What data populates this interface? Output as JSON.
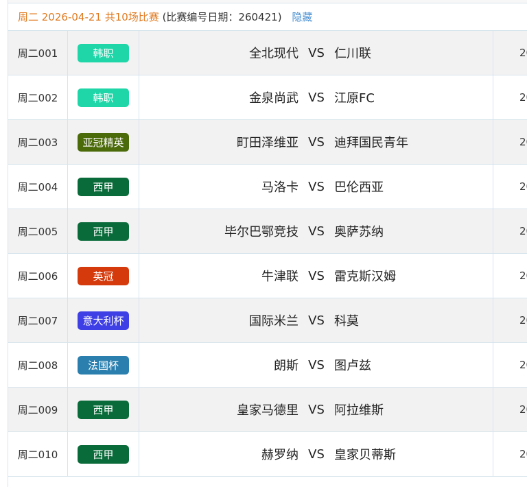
{
  "header": {
    "date_text": "周二 2026-04-21 共10场比赛",
    "code_text": "(比赛编号日期：260421)",
    "hide_link": "隐藏"
  },
  "vs_label": "VS",
  "matches": [
    {
      "id": "周二001",
      "league": "韩职",
      "color": "#1ed6a8",
      "home": "全北现代",
      "away": "仁川联",
      "time": "20"
    },
    {
      "id": "周二002",
      "league": "韩职",
      "color": "#1ed6a8",
      "home": "金泉尚武",
      "away": "江原FC",
      "time": "20"
    },
    {
      "id": "周二003",
      "league": "亚冠精英",
      "color": "#4b6a0a",
      "home": "町田泽维亚",
      "away": "迪拜国民青年",
      "time": "20"
    },
    {
      "id": "周二004",
      "league": "西甲",
      "color": "#0a6b3a",
      "home": "马洛卡",
      "away": "巴伦西亚",
      "time": "20"
    },
    {
      "id": "周二005",
      "league": "西甲",
      "color": "#0a6b3a",
      "home": "毕尔巴鄂竞技",
      "away": "奥萨苏纳",
      "time": "20"
    },
    {
      "id": "周二006",
      "league": "英冠",
      "color": "#d43a0c",
      "home": "牛津联",
      "away": "雷克斯汉姆",
      "time": "20"
    },
    {
      "id": "周二007",
      "league": "意大利杯",
      "color": "#3f3fe6",
      "home": "国际米兰",
      "away": "科莫",
      "time": "20"
    },
    {
      "id": "周二008",
      "league": "法国杯",
      "color": "#2a7fae",
      "home": "朗斯",
      "away": "图卢兹",
      "time": "20"
    },
    {
      "id": "周二009",
      "league": "西甲",
      "color": "#0a6b3a",
      "home": "皇家马德里",
      "away": "阿拉维斯",
      "time": "20"
    },
    {
      "id": "周二010",
      "league": "西甲",
      "color": "#0a6b3a",
      "home": "赫罗纳",
      "away": "皇家贝蒂斯",
      "time": "20"
    }
  ]
}
